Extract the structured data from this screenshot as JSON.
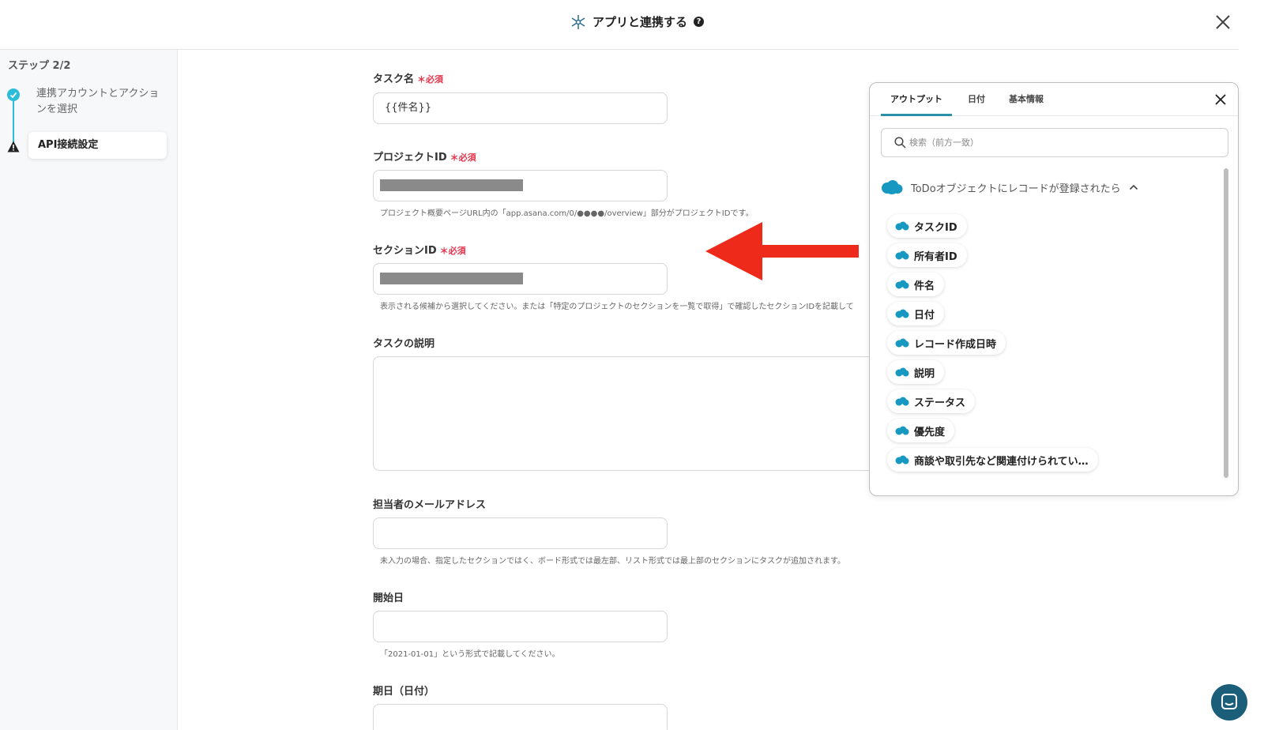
{
  "header": {
    "title": "アプリと連携する",
    "help_icon": "?",
    "close_icon": "close-icon"
  },
  "sidebar": {
    "step_label": "ステップ 2/2",
    "steps": [
      {
        "label": "連携アカウントとアクションを選択",
        "status": "done"
      },
      {
        "label": "API接続設定",
        "status": "warning"
      }
    ]
  },
  "form": {
    "required_label": "必須",
    "task_name": {
      "label": "タスク名",
      "value": "{{件名}}"
    },
    "project_id": {
      "label": "プロジェクトID",
      "hint": "プロジェクト概要ページURL内の「app.asana.com/0/●●●●/overview」部分がプロジェクトIDです。"
    },
    "section_id": {
      "label": "セクションID",
      "hint": "表示される候補から選択してください。または「特定のプロジェクトのセクションを一覧で取得」で確認したセクションIDを記載して"
    },
    "description": {
      "label": "タスクの説明"
    },
    "assignee_email": {
      "label": "担当者のメールアドレス",
      "hint": "未入力の場合、指定したセクションではく、ボード形式では最左部、リスト形式では最上部のセクションにタスクが追加されます。"
    },
    "start_date": {
      "label": "開始日",
      "hint": "「2021-01-01」という形式で記載してください。"
    },
    "due_date": {
      "label": "期日（日付）"
    }
  },
  "panel": {
    "tabs": [
      "アウトプット",
      "日付",
      "基本情報"
    ],
    "active_tab": "アウトプット",
    "search_placeholder": "検索（前方一致）",
    "group_title": "ToDoオブジェクトにレコードが登録されたら",
    "items": [
      "タスクID",
      "所有者ID",
      "件名",
      "日付",
      "レコード作成日時",
      "説明",
      "ステータス",
      "優先度",
      "商談や取引先など関連付けられてい…"
    ]
  },
  "colors": {
    "accent": "#2bbcd8",
    "required": "#e5334a",
    "arrow": "#ee2a1a",
    "salesforce": "#1798c1",
    "chat": "#1a5e7a"
  }
}
